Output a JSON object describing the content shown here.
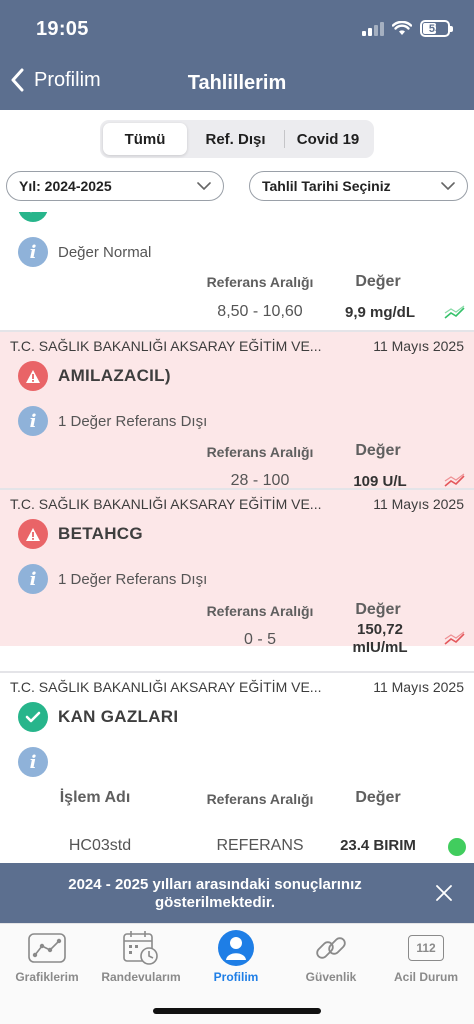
{
  "status_bar": {
    "time": "19:05",
    "battery": "53",
    "battery_level": 0.53
  },
  "header": {
    "back_label": "Profilim",
    "title": "Tahlillerim"
  },
  "segments": [
    {
      "label": "Tümü",
      "active": true
    },
    {
      "label": "Ref. Dışı",
      "active": false
    },
    {
      "label": "Covid 19",
      "active": false
    }
  ],
  "filters": {
    "year": "Yıl: 2024-2025",
    "date": "Tahlil Tarihi Seçiniz"
  },
  "results": [
    {
      "status": "normal",
      "info": "Değer Normal",
      "ref_header": "Referans Aralığı",
      "value_header": "Değer",
      "ref_range": "8,50 - 10,60",
      "value": "9,9 mg/dL",
      "trend_color": "#35c26a"
    },
    {
      "hospital": "T.C. SAĞLIK BAKANLIĞI AKSARAY EĞİTİM VE...",
      "date": "11 Mayıs 2025",
      "status": "alert",
      "name": "AMILAZACIL)",
      "info": "1 Değer Referans Dışı",
      "ref_header": "Referans Aralığı",
      "value_header": "Değer",
      "ref_range": "28 - 100",
      "value": "109 U/L",
      "trend_color": "#e4575b"
    },
    {
      "hospital": "T.C. SAĞLIK BAKANLIĞI AKSARAY EĞİTİM VE...",
      "date": "11 Mayıs 2025",
      "status": "alert",
      "name": "BETAHCG",
      "info": "1 Değer Referans Dışı",
      "ref_header": "Referans Aralığı",
      "value_header": "Değer",
      "ref_range": "0 - 5",
      "value_line1": "150,72",
      "value_line2": "mIU/mL",
      "trend_color": "#e4575b"
    },
    {
      "hospital": "T.C. SAĞLIK BAKANLIĞI AKSARAY EĞİTİM VE...",
      "date": "11 Mayıs 2025",
      "status": "ok",
      "name": "KAN GAZLARI",
      "columns": {
        "name": "İşlem Adı",
        "ref": "Referans Aralığı",
        "value": "Değer"
      },
      "row": {
        "name": "HC03std",
        "ref": "REFERANS",
        "value": "23.4 BIRIM",
        "dot_color": "#41cd5e"
      }
    }
  ],
  "banner": {
    "text": "2024 - 2025 yılları arasındaki sonuçlarınız gösterilmektedir."
  },
  "tabs": [
    {
      "label": "Grafiklerim",
      "icon": "chart-icon",
      "active": false
    },
    {
      "label": "Randevularım",
      "icon": "calendar-clock-icon",
      "active": false
    },
    {
      "label": "Profilim",
      "icon": "person-icon",
      "active": true
    },
    {
      "label": "Güvenlik",
      "icon": "link-icon",
      "active": false
    },
    {
      "label": "Acil Durum",
      "icon": "emergency-112-icon",
      "active": false,
      "badge": "112"
    }
  ],
  "colors": {
    "header_bg": "#5c6f8f",
    "alert_bg": "#fce7e8",
    "warn_icon": "#e96467",
    "ok_icon": "#27b58b",
    "info_icon": "#8fb2d9",
    "active_tab": "#1e7ee6"
  }
}
